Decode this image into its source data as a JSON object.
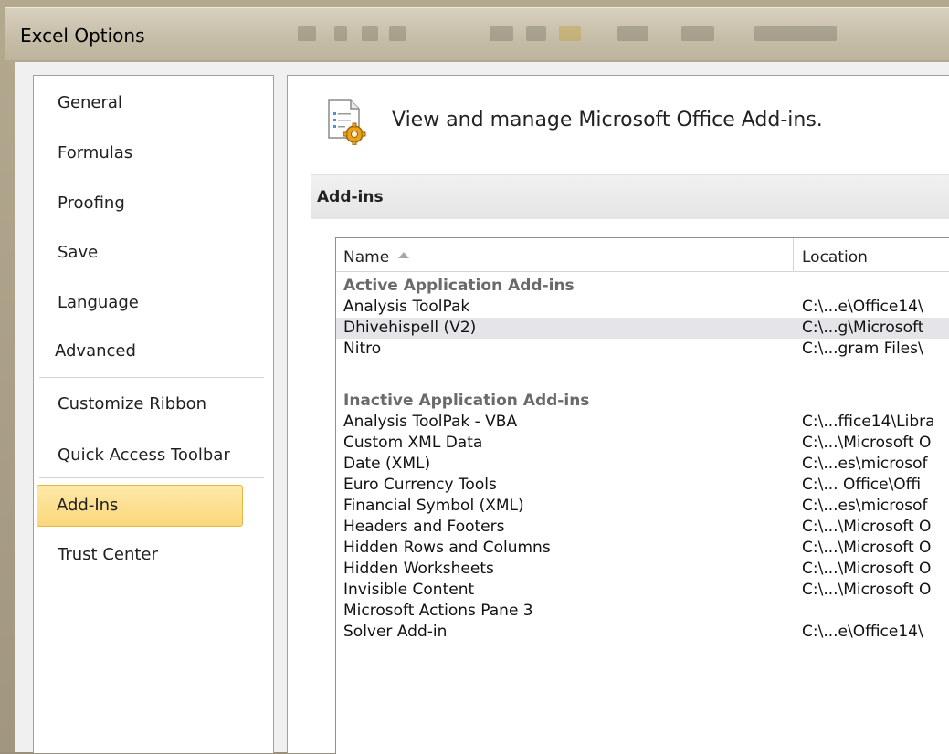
{
  "window": {
    "title": "Excel Options"
  },
  "nav": {
    "items": [
      {
        "label": "General"
      },
      {
        "label": "Formulas"
      },
      {
        "label": "Proofing"
      },
      {
        "label": "Save"
      },
      {
        "label": "Language"
      },
      {
        "label": "Advanced"
      },
      {
        "label": "Customize Ribbon"
      },
      {
        "label": "Quick Access Toolbar"
      },
      {
        "label": "Add-Ins"
      },
      {
        "label": "Trust Center"
      }
    ],
    "selected": "Add-Ins"
  },
  "main": {
    "header": "View and manage Microsoft Office Add-ins.",
    "section_title": "Add-ins",
    "table": {
      "columns": {
        "name": "Name",
        "location": "Location"
      },
      "sort": "ascending",
      "groups": {
        "active": "Active Application Add-ins",
        "inactive": "Inactive Application Add-ins"
      },
      "active_rows": [
        {
          "name": "Analysis ToolPak",
          "location": "C:\\...e\\Office14\\"
        },
        {
          "name": "Dhivehispell (V2)",
          "location": "C:\\...g\\Microsoft"
        },
        {
          "name": "Nitro",
          "location": "C:\\...gram Files\\"
        }
      ],
      "inactive_rows": [
        {
          "name": "Analysis ToolPak - VBA",
          "location": "C:\\...ffice14\\Libra"
        },
        {
          "name": "Custom XML Data",
          "location": "C:\\...\\Microsoft O"
        },
        {
          "name": "Date (XML)",
          "location": "C:\\...es\\microsof"
        },
        {
          "name": "Euro Currency Tools",
          "location": "C:\\... Office\\Offi"
        },
        {
          "name": "Financial Symbol (XML)",
          "location": "C:\\...es\\microsof"
        },
        {
          "name": "Headers and Footers",
          "location": "C:\\...\\Microsoft O"
        },
        {
          "name": "Hidden Rows and Columns",
          "location": "C:\\...\\Microsoft O"
        },
        {
          "name": "Hidden Worksheets",
          "location": "C:\\...\\Microsoft O"
        },
        {
          "name": "Invisible Content",
          "location": "C:\\...\\Microsoft O"
        },
        {
          "name": "Microsoft Actions Pane 3",
          "location": ""
        },
        {
          "name": "Solver Add-in",
          "location": "C:\\...e\\Office14\\"
        }
      ],
      "selected_row": "Dhivehispell (V2)"
    }
  },
  "colors": {
    "nav_selected_bg": "#fbd77c",
    "nav_selected_border": "#e5b744",
    "row_selected_bg": "#e5e5e9",
    "group_text": "#6a6a6a"
  }
}
